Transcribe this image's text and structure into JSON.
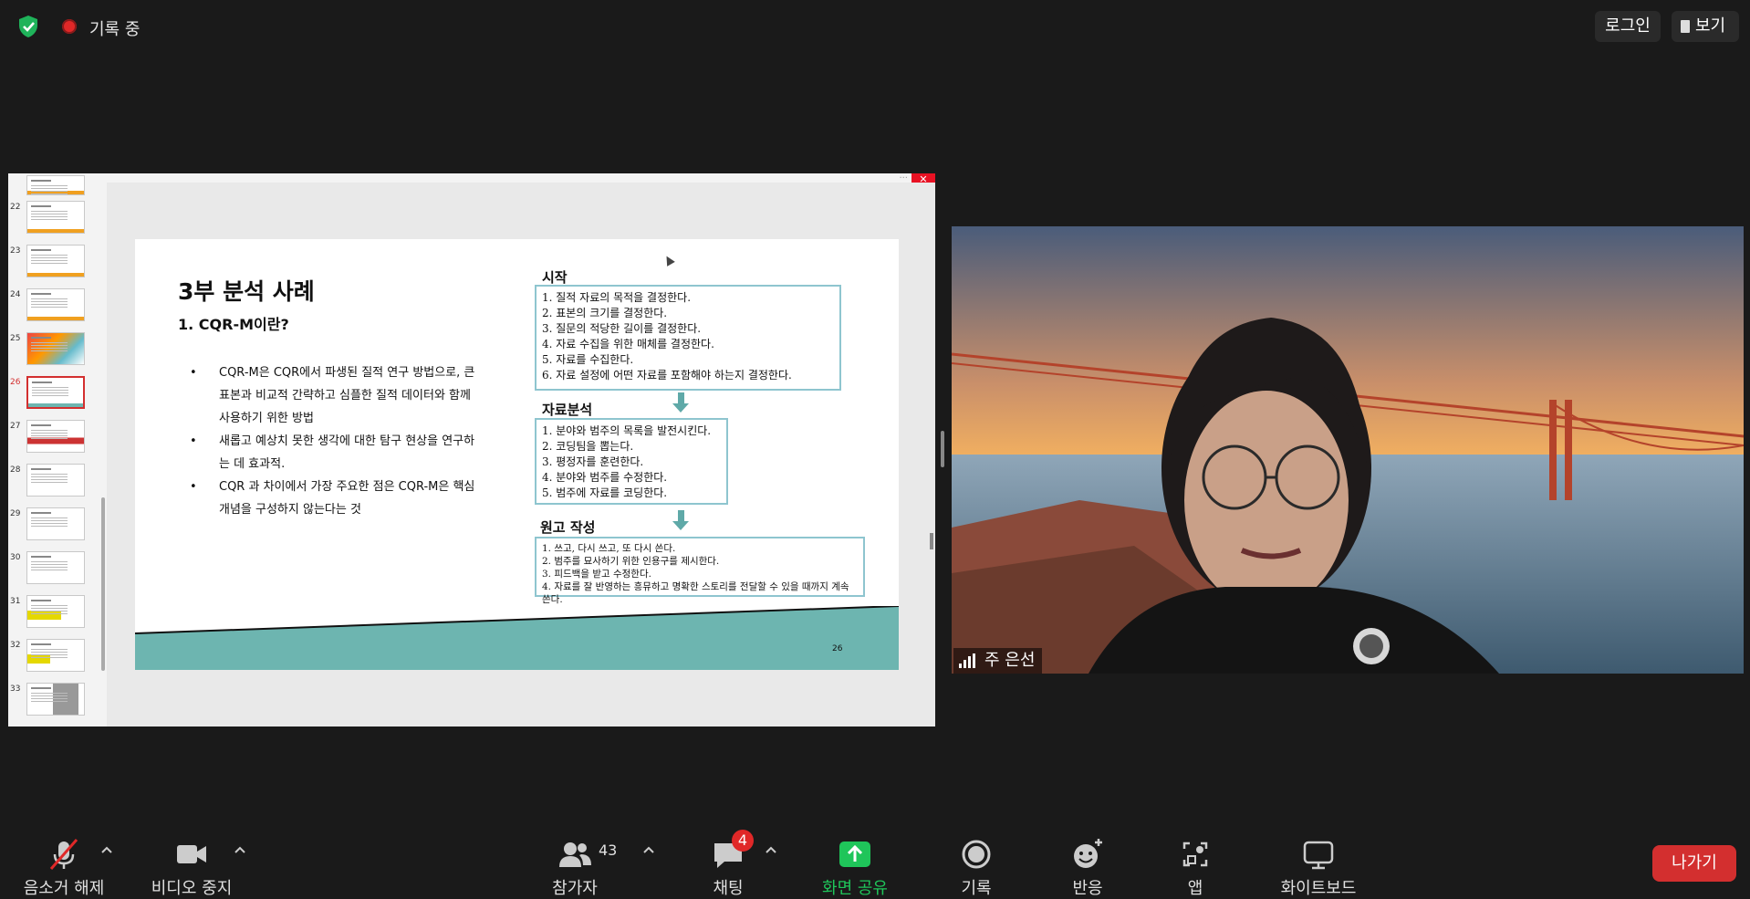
{
  "top": {
    "recording_label": "기록 중",
    "login_label": "로그인",
    "view_label": "보기"
  },
  "thumbnails": {
    "numbers": [
      "22",
      "23",
      "24",
      "25",
      "26",
      "27",
      "28",
      "29",
      "30",
      "31",
      "32",
      "33"
    ],
    "active_number": "26"
  },
  "slide": {
    "title": "3부 분석 사례",
    "subtitle": "1. CQR-M이란?",
    "bullets": [
      "CQR-M은 CQR에서 파생된 질적 연구 방법으로, 큰 표본과 비교적 간략하고 심플한 질적 데이터와 함께 사용하기 위한 방법",
      "새롭고 예상치 못한 생각에 대한 탐구 현상을 연구하는 데 효과적.",
      "CQR 과 차이에서 가장 주요한 점은 CQR-M은 핵심 개념을 구성하지 않는다는 것"
    ],
    "section1_label": "시작",
    "section1_items": [
      "1. 질적 자료의 목적을 결정한다.",
      "2. 표본의 크기를 결정한다.",
      "3. 질문의 적당한 길이를 결정한다.",
      "4. 자료 수집을 위한 매체를 결정한다.",
      "5. 자료를 수집한다.",
      "6. 자료 설정에 어떤 자료를 포함해야 하는지 결정한다."
    ],
    "section2_label": "자료분석",
    "section2_items": [
      "1. 분야와 범주의 목록을 발전시킨다.",
      "2. 코딩팀을 뽑는다.",
      "3. 평정자를 훈련한다.",
      "4. 분야와 범주를 수정한다.",
      "5. 범주에 자료를 코딩한다."
    ],
    "section3_label": "원고 작성",
    "section3_items": [
      "1. 쓰고, 다시 쓰고, 또 다시 쓴다.",
      "2. 범주를 묘사하기 위한 인용구를 제시한다.",
      "3. 피드백을 받고 수정한다.",
      "4. 자료를 잘 반영하는 흥뮤하고 명확한 스토리를 전달할 수 있을 때까지 계속 쓴다."
    ],
    "page_number": "26",
    "band_color": "#6db5b0"
  },
  "video": {
    "participant_name": "주 은선"
  },
  "toolbar": {
    "unmute_label": "음소거 해제",
    "stop_video_label": "비디오 중지",
    "participants_label": "참가자",
    "participants_count": "43",
    "chat_label": "채팅",
    "chat_badge": "4",
    "share_label": "화면 공유",
    "record_label": "기록",
    "reactions_label": "반응",
    "apps_label": "앱",
    "whiteboard_label": "화이트보드",
    "leave_label": "나가기",
    "share_color": "#1fc55a",
    "leave_color": "#d32f2f"
  }
}
